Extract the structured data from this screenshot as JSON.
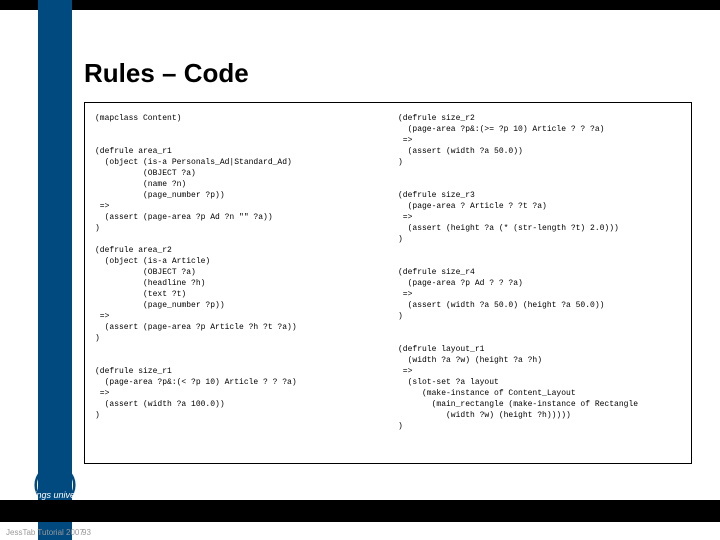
{
  "slide": {
    "title": "Rules – Code",
    "footer_university": "Linköpings universitet",
    "credit": "JessTab Tutorial 2007",
    "page_number": "93"
  },
  "code": {
    "left": "(mapclass Content)\n\n\n(defrule area_r1\n  (object (is-a Personals_Ad|Standard_Ad)\n          (OBJECT ?a)\n          (name ?n)\n          (page_number ?p))\n =>\n  (assert (page-area ?p Ad ?n \"\" ?a))\n)\n\n(defrule area_r2\n  (object (is-a Article)\n          (OBJECT ?a)\n          (headline ?h)\n          (text ?t)\n          (page_number ?p))\n =>\n  (assert (page-area ?p Article ?h ?t ?a))\n)\n\n\n(defrule size_r1\n  (page-area ?p&:(< ?p 10) Article ? ? ?a)\n =>\n  (assert (width ?a 100.0))\n)",
    "right": "(defrule size_r2\n  (page-area ?p&:(>= ?p 10) Article ? ? ?a)\n =>\n  (assert (width ?a 50.0))\n)\n\n\n(defrule size_r3\n  (page-area ? Article ? ?t ?a)\n =>\n  (assert (height ?a (* (str-length ?t) 2.0)))\n)\n\n\n(defrule size_r4\n  (page-area ?p Ad ? ? ?a)\n =>\n  (assert (width ?a 50.0) (height ?a 50.0))\n)\n\n\n(defrule layout_r1\n  (width ?a ?w) (height ?a ?h)\n =>\n  (slot-set ?a layout\n     (make-instance of Content_Layout\n       (main_rectangle (make-instance of Rectangle\n          (width ?w) (height ?h)))))\n)"
  }
}
